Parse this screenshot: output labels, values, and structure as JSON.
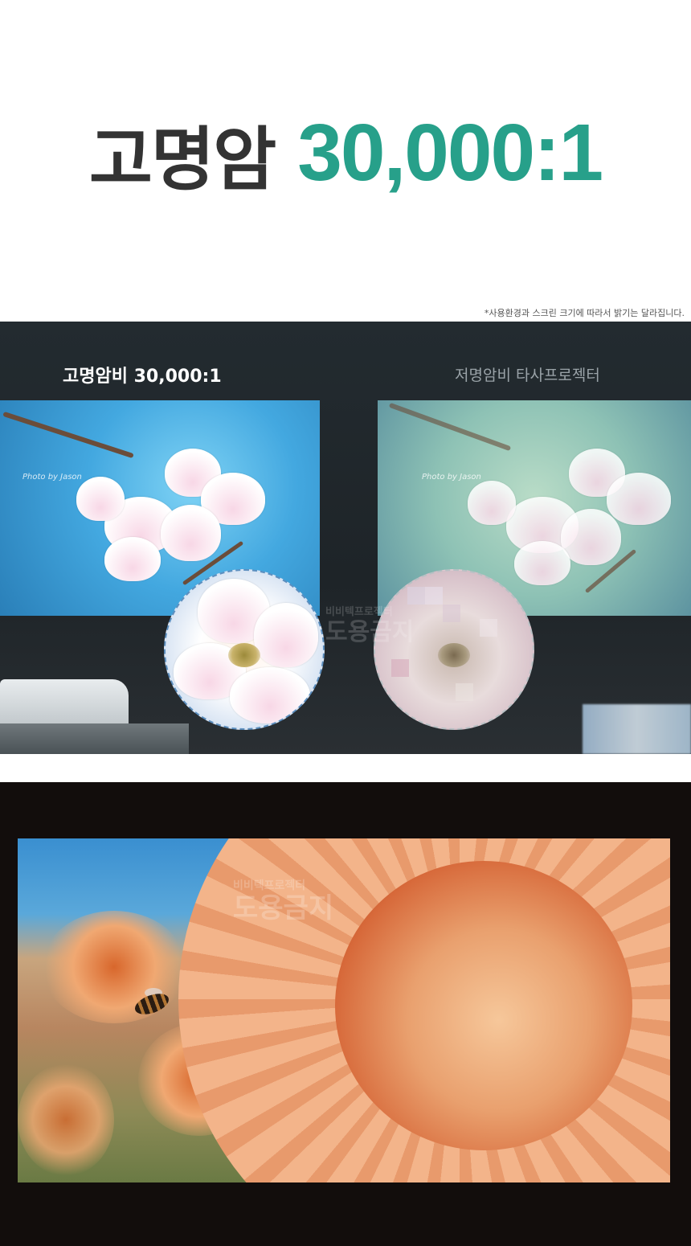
{
  "hero": {
    "title_ko": "고명암",
    "title_ratio": "30,000:1",
    "colors": {
      "text_dark": "#333333",
      "accent": "#27a08a"
    }
  },
  "disclaimer": "*사용환경과 스크린 크기에 따라서 밝기는 달라집니다.",
  "comparison": {
    "left_label": "고명암비 30,000:1",
    "right_label": "저명암비 타사프로젝터",
    "photo_signature": "Photo by Jason",
    "watermark_top": "비비텍프로젝터",
    "watermark_bottom": "도용금지"
  },
  "sunflower": {
    "watermark_top": "비비텍프로젝터",
    "watermark_bottom": "도용금지"
  },
  "icons": {
    "bee": "bee-icon"
  }
}
